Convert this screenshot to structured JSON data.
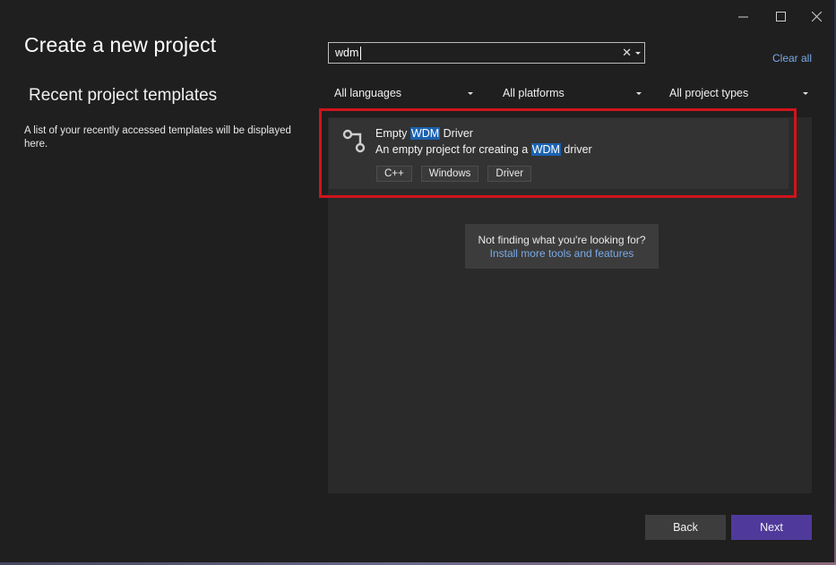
{
  "window": {
    "controls": {
      "minimize": "minimize-icon",
      "maximize": "maximize-icon",
      "close": "close-icon"
    }
  },
  "header": {
    "title": "Create a new project"
  },
  "recent": {
    "title": "Recent project templates",
    "description": "A list of your recently accessed templates will be displayed here."
  },
  "search": {
    "value": "wdm",
    "clear_glyph": "✕"
  },
  "clear_all_label": "Clear all",
  "filters": {
    "language": "All languages",
    "platform": "All platforms",
    "project_type": "All project types"
  },
  "results": [
    {
      "name_prefix": "Empty ",
      "name_highlight": "WDM",
      "name_suffix": " Driver",
      "desc_prefix": "An empty project for creating a ",
      "desc_highlight": "WDM",
      "desc_suffix": " driver",
      "tags": [
        "C++",
        "Windows",
        "Driver"
      ],
      "icon": "driver-template-icon"
    }
  ],
  "not_found": {
    "question": "Not finding what you're looking for?",
    "link": "Install more tools and features"
  },
  "buttons": {
    "back": "Back",
    "next": "Next"
  },
  "colors": {
    "background": "#1f1f1f",
    "accent_link": "#7aa9e6",
    "highlight": "#1b62b0",
    "next_button": "#4f3a9c",
    "annotation_box": "#d0141b"
  }
}
